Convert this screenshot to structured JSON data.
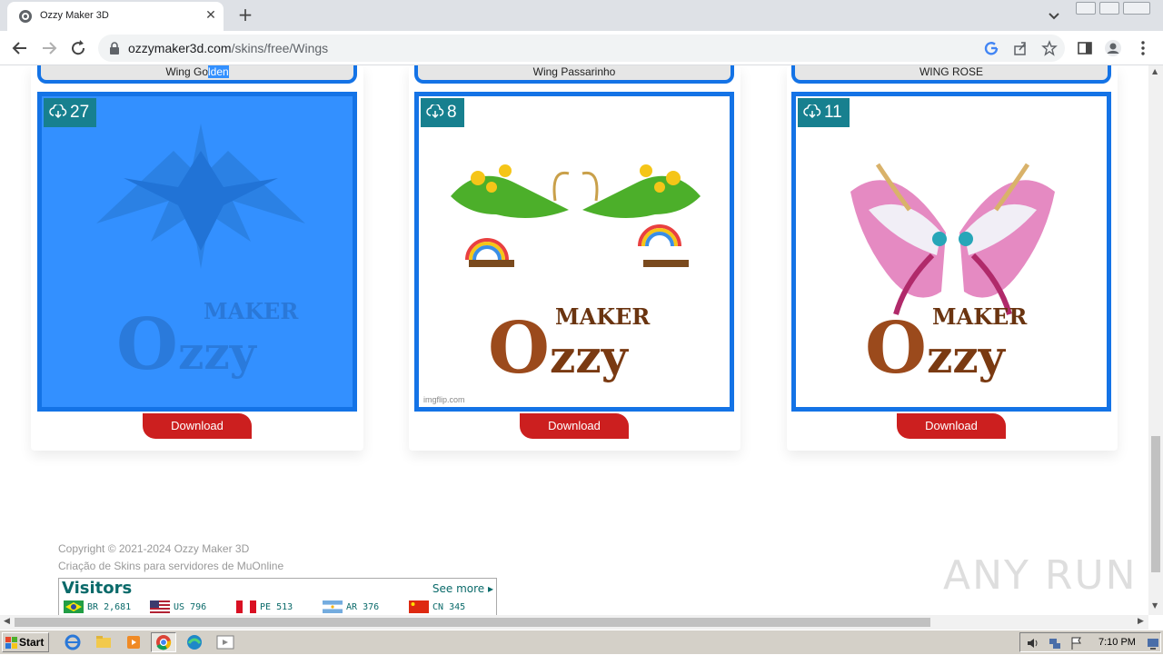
{
  "browser": {
    "tab_title": "Ozzy Maker 3D",
    "url_domain": "ozzymaker3d.com",
    "url_path": "/skins/free/Wings"
  },
  "cards": [
    {
      "name_pre": "Wing Go",
      "name_sel": "lden",
      "downloads": "27",
      "download_label": "Download",
      "selected": true
    },
    {
      "name_pre": "Wing Passarinho",
      "name_sel": "",
      "downloads": "8",
      "download_label": "Download",
      "selected": false,
      "watermark": "imgflip.com"
    },
    {
      "name_pre": "WING ROSE",
      "name_sel": "",
      "downloads": "11",
      "download_label": "Download",
      "selected": false
    }
  ],
  "logo": {
    "maker": "MAKER",
    "ozzy_o": "O",
    "ozzy_rest": "zzy"
  },
  "footer": {
    "copyright": "Copyright © 2021-2024 Ozzy Maker 3D",
    "tagline": "Criação de Skins para servidores de MuOnline"
  },
  "visitors": {
    "title": "Visitors",
    "see_more": "See more",
    "entries": [
      {
        "code": "BR",
        "count": "2,681",
        "flag": "brazil"
      },
      {
        "code": "US",
        "count": "796",
        "flag": "usa"
      },
      {
        "code": "PE",
        "count": "513",
        "flag": "peru"
      },
      {
        "code": "AR",
        "count": "376",
        "flag": "argentina"
      },
      {
        "code": "CN",
        "count": "345",
        "flag": "china"
      }
    ]
  },
  "watermark": "ANY RUN",
  "taskbar": {
    "start_label": "Start",
    "clock": "7:10 PM"
  },
  "colors": {
    "frame_blue": "#1473e6",
    "badge_teal": "#17808f",
    "download_red": "#cc1f1f",
    "selection_blue": "#3390ff"
  }
}
